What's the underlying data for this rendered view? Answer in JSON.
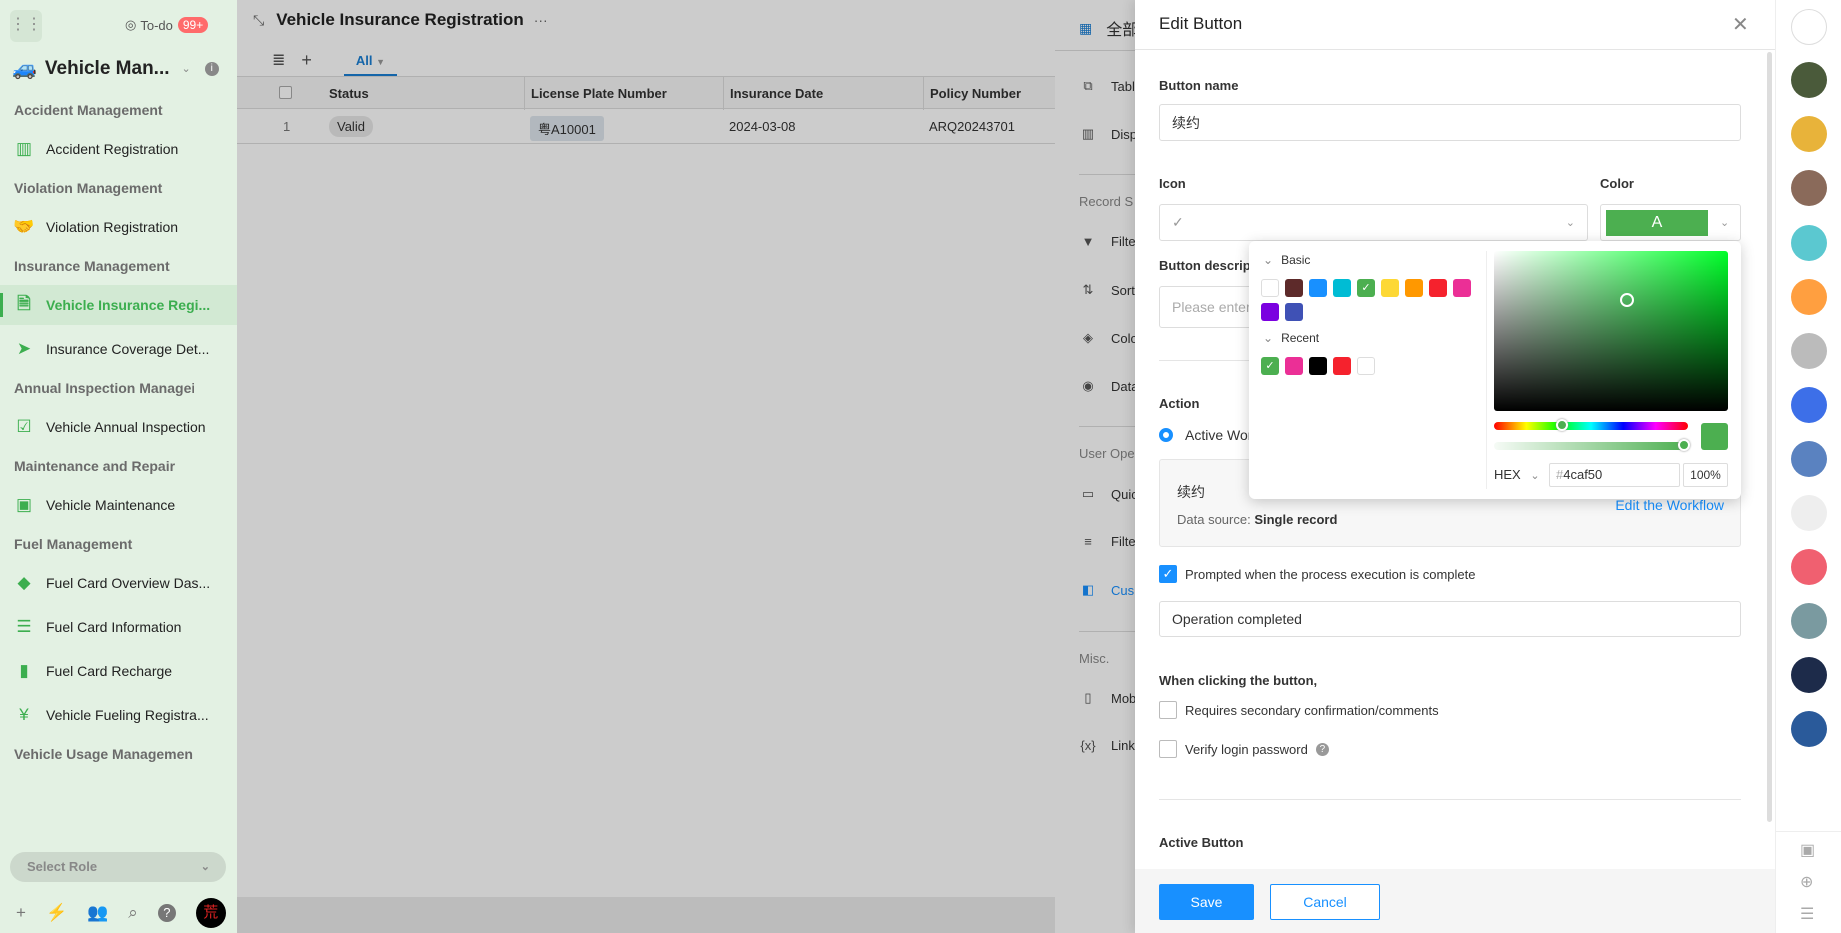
{
  "sidebar": {
    "todo_label": "To-do",
    "todo_badge": "99+",
    "app_name": "Vehicle Man...",
    "groups": [
      {
        "title": "Accident Management",
        "items": [
          {
            "label": "Accident Registration",
            "icon": "calculator-icon"
          }
        ]
      },
      {
        "title": "Violation Management",
        "items": [
          {
            "label": "Violation Registration",
            "icon": "handshake-icon"
          }
        ]
      },
      {
        "title": "Insurance Management",
        "items": [
          {
            "label": "Vehicle Insurance Regi...",
            "icon": "document-search-icon",
            "active": true
          },
          {
            "label": "Insurance Coverage Det...",
            "icon": "send-icon"
          }
        ]
      },
      {
        "title": "Annual Inspection Managei",
        "items": [
          {
            "label": "Vehicle Annual Inspection",
            "icon": "clipboard-check-icon"
          }
        ]
      },
      {
        "title": "Maintenance and Repair",
        "items": [
          {
            "label": "Vehicle Maintenance",
            "icon": "toolbox-icon"
          }
        ]
      },
      {
        "title": "Fuel Management",
        "items": [
          {
            "label": "Fuel Card Overview Das...",
            "icon": "shapes-icon"
          },
          {
            "label": "Fuel Card Information",
            "icon": "list-icon"
          },
          {
            "label": "Fuel Card Recharge",
            "icon": "bar-chart-icon"
          },
          {
            "label": "Vehicle Fueling Registra...",
            "icon": "yen-icon"
          }
        ]
      },
      {
        "title": "Vehicle Usage Managemen",
        "items": []
      }
    ],
    "select_role": "Select Role"
  },
  "main": {
    "title": "Vehicle Insurance Registration",
    "view_tab": "All",
    "columns": [
      "Status",
      "License Plate Number",
      "Insurance Date",
      "Policy Number"
    ],
    "rows": [
      {
        "index": "1",
        "status": "Valid",
        "plate": "粤A10001",
        "date": "2024-03-08",
        "policy": "ARQ20243701"
      }
    ]
  },
  "settings": {
    "view_name": "全部",
    "items": [
      {
        "type": "item",
        "label": "Table",
        "icon": "table-icon"
      },
      {
        "type": "item",
        "label": "Display",
        "icon": "columns-icon"
      },
      {
        "type": "header",
        "label": "Record S"
      },
      {
        "type": "item",
        "label": "Filter",
        "icon": "filter-icon"
      },
      {
        "type": "item",
        "label": "Sort",
        "icon": "sort-icon"
      },
      {
        "type": "item",
        "label": "Color",
        "icon": "paint-bucket-icon"
      },
      {
        "type": "item",
        "label": "Data",
        "icon": "eye-icon"
      },
      {
        "type": "header",
        "label": "User Ope"
      },
      {
        "type": "item",
        "label": "Quic",
        "icon": "quick-icon"
      },
      {
        "type": "item",
        "label": "Filte",
        "icon": "list-filter-icon"
      },
      {
        "type": "item",
        "label": "Cus",
        "icon": "custom-button-icon",
        "active": true
      },
      {
        "type": "header",
        "label": "Misc."
      },
      {
        "type": "item",
        "label": "Mob",
        "icon": "mobile-icon"
      },
      {
        "type": "item",
        "label": "Link",
        "icon": "variable-icon"
      }
    ]
  },
  "drawer": {
    "title": "Edit Button",
    "button_name_label": "Button name",
    "button_name_value": "续约",
    "icon_label": "Icon",
    "color_label": "Color",
    "color_preview_letter": "A",
    "description_label": "Button descrip",
    "description_placeholder": "Please enter",
    "action_label": "Action",
    "action_option": "Active Wor",
    "workflow_name": "续约",
    "data_source_label": "Data source:",
    "data_source_value": "Single record",
    "edit_workflow": "Edit the Workflow",
    "prompt_label": "Prompted when the process execution is complete",
    "prompt_checked": true,
    "prompt_message": "Operation completed",
    "when_clicking_label": "When clicking the button,",
    "secondary_confirm_label": "Requires secondary confirmation/comments",
    "verify_password_label": "Verify login password",
    "active_button_label": "Active Button",
    "save": "Save",
    "cancel": "Cancel"
  },
  "color_picker": {
    "basic_label": "Basic",
    "recent_label": "Recent",
    "basic": [
      "#ffffff",
      "#5d2a2a",
      "#1890ff",
      "#00bcd4",
      "#4caf50",
      "#fdd835",
      "#ff9800",
      "#f5222d",
      "#eb2f96",
      "#7b00e0",
      "#3f51b5"
    ],
    "recent": [
      "#4caf50",
      "#eb2f96",
      "#000000",
      "#f5222d",
      "#ffffff"
    ],
    "selected": "#4caf50",
    "format": "HEX",
    "hex": "4caf50",
    "alpha": "100%"
  },
  "colors": {
    "accent": "#3cae4f",
    "primary": "#1890ff",
    "selected_color": "#4caf50"
  }
}
